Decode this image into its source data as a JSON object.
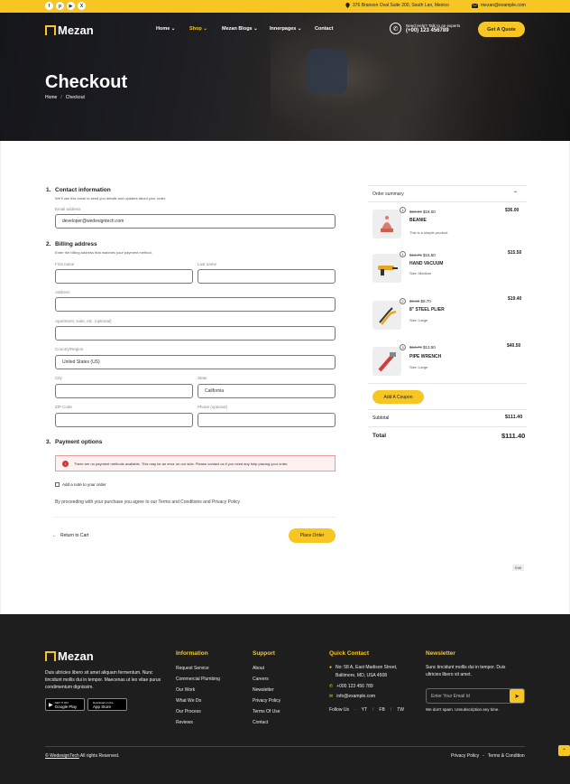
{
  "topbar": {
    "address": "376 Branson Oval Suite 200, South Lan, Mexico",
    "email": "mezan@example.com",
    "social": [
      "f",
      "p",
      "▶",
      "X"
    ]
  },
  "header": {
    "logo": "Mezan",
    "nav": [
      "Home",
      "Shop",
      "Mezan Blogs",
      "Innerpages",
      "Contact"
    ],
    "help_label": "Need Help? Talk to an experts",
    "help_phone": "(+00) 123 456789",
    "quote_button": "Get A Quote"
  },
  "page": {
    "title": "Checkout",
    "breadcrumb_home": "Home",
    "breadcrumb_sep": "/",
    "breadcrumb_current": "Checkout"
  },
  "contact": {
    "step": "1.",
    "title": "Contact information",
    "subtitle": "We'll use this email to send you details and updates about your order.",
    "email_label": "Email address",
    "email_value": "developer@wedesigntech.com"
  },
  "billing": {
    "step": "2.",
    "title": "Billing address",
    "subtitle": "Enter the billing address that matches your payment method.",
    "first_name_label": "First name",
    "last_name_label": "Last name",
    "address_label": "Address",
    "apartment_label": "Apartment, suite, etc. (optional)",
    "country_label": "Country/Region",
    "country_value": "United States (US)",
    "city_label": "City",
    "state_label": "State",
    "state_value": "California",
    "zip_label": "ZIP Code",
    "phone_label": "Phone (optional)"
  },
  "payment": {
    "step": "3.",
    "title": "Payment options",
    "notice": "There are no payment methods available. This may be an error on our side. Please contact us if you need any help placing your order.",
    "note_checkbox": "Add a note to your order",
    "terms": "By proceeding with your purchase you agree to our Terms and Conditions and Privacy Policy",
    "return_link": "Return to Cart",
    "place_order": "Place Order"
  },
  "summary": {
    "title": "Order summary",
    "items": [
      {
        "qty": "1",
        "old": "$20.00",
        "new": "$18.00",
        "name": "BEANIE",
        "desc": "This is a simple product.",
        "total": "$36.00"
      },
      {
        "qty": "1",
        "old": "$15.75",
        "new": "$15.50",
        "name": "HAND VACUUM",
        "desc": "Size: Medium",
        "total": "$15.50"
      },
      {
        "qty": "2",
        "old": "$9.80",
        "new": "$9.70",
        "name": "8\" STEEL PLIER",
        "desc": "Size: Large",
        "total": "$19.40"
      },
      {
        "qty": "3",
        "old": "$13.70",
        "new": "$13.50",
        "name": "PIPE WRENCH",
        "desc": "Size: Large",
        "total": "$40.50"
      }
    ],
    "coupon": "Add A Coupon",
    "subtotal_label": "Subtotal",
    "subtotal_value": "$111.40",
    "total_label": "Total",
    "total_value": "$111.40"
  },
  "edit_label": "Edit",
  "footer": {
    "logo": "Mezan",
    "about": "Duis ultricies libero sit amet aliquam fermentum. Nunc tincidunt mollis dui in tempor. Maecenas ut leo vitae purus condimentum dignissim.",
    "google_play": "Google Play",
    "google_play_pre": "GET IT ON",
    "app_store": "App Store",
    "app_store_pre": "Download on the",
    "information_title": "Information",
    "information": [
      "Request Service",
      "Commercial Plumbing",
      "Our Work",
      "What We Do",
      "Our Process",
      "Reviews"
    ],
    "support_title": "Support",
    "support": [
      "About",
      "Careers",
      "Newsletter",
      "Privacy Policy",
      "Terms Of Use",
      "Contact"
    ],
    "quick_title": "Quick Contact",
    "quick_address": "No: 58 A, East Madison Street, Baltimore, MD, USA 4508",
    "quick_phone": "+000 123 456 789",
    "quick_email": "info@example.com",
    "follow": "Follow Us",
    "follow_links": [
      "YT",
      "FB",
      "TW"
    ],
    "newsletter_title": "Newsletter",
    "newsletter_text": "Sunc tincidunt mollis dui in tempor. Duis ultricies libero sit amet.",
    "newsletter_placeholder": "Enter Your Email Id",
    "newsletter_note": "We don't spam. Unsubscription any time.",
    "copyright_brand": "© WedesignTech",
    "copyright_rest": " All rights Reserved.",
    "bottom_links": [
      "Privacy Policy",
      "Terms & Condition"
    ]
  },
  "colors": {
    "accent": "#f7c623",
    "dark": "#1e1e1f"
  }
}
